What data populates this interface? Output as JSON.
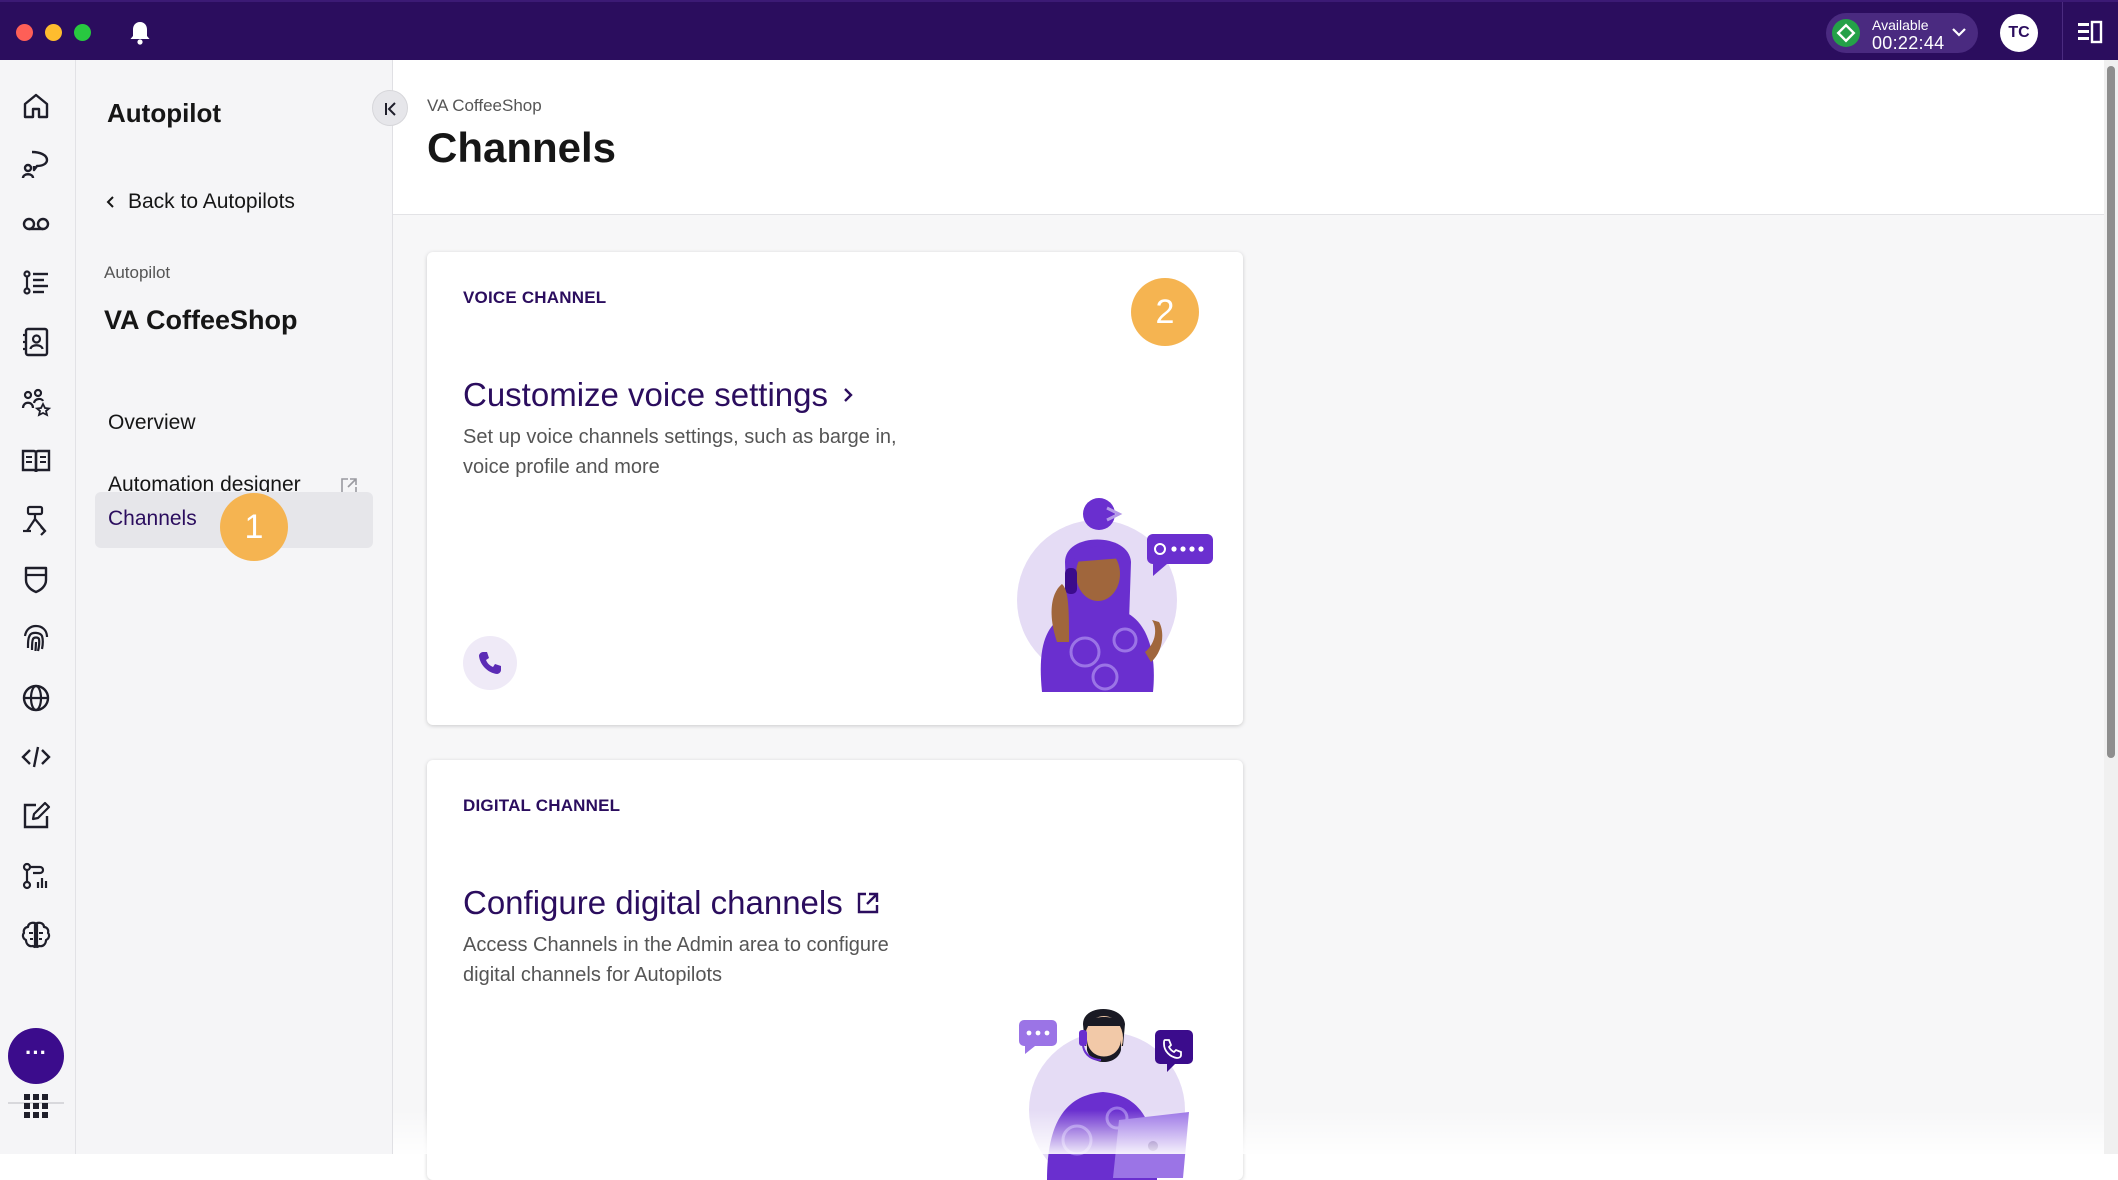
{
  "topbar": {
    "status_label": "Available",
    "status_time": "00:22:44",
    "avatar_initials": "TC"
  },
  "rail": {
    "items": [
      "home-icon",
      "conversation-icon",
      "voicemail-icon",
      "list-icon",
      "contact-card-icon",
      "team-icon",
      "book-icon",
      "flow-icon",
      "shield-icon",
      "fingerprint-icon",
      "globe-icon",
      "code-icon",
      "edit-icon",
      "analytics-icon",
      "brain-icon"
    ],
    "more_label": "···"
  },
  "sidebar": {
    "title": "Autopilot",
    "back_label": "Back to Autopilots",
    "caption": "Autopilot",
    "name": "VA CoffeeShop",
    "items": [
      {
        "label": "Overview"
      },
      {
        "label": "Automation designer"
      },
      {
        "label": "Channels"
      }
    ],
    "badge": "1"
  },
  "main": {
    "breadcrumb": "VA CoffeeShop",
    "title": "Channels",
    "voice": {
      "kicker": "VOICE CHANNEL",
      "title": "Customize voice settings",
      "description": "Set up voice channels settings, such as barge in, voice profile and more",
      "badge": "2"
    },
    "digital": {
      "kicker": "DIGITAL CHANNEL",
      "title": "Configure digital channels",
      "description": "Access Channels in the Admin area to configure digital channels for Autopilots"
    }
  },
  "colors": {
    "topbar": "#2b0d5e",
    "accent": "#2b0d5e",
    "badge": "#f5b451",
    "status": "#24a148"
  }
}
